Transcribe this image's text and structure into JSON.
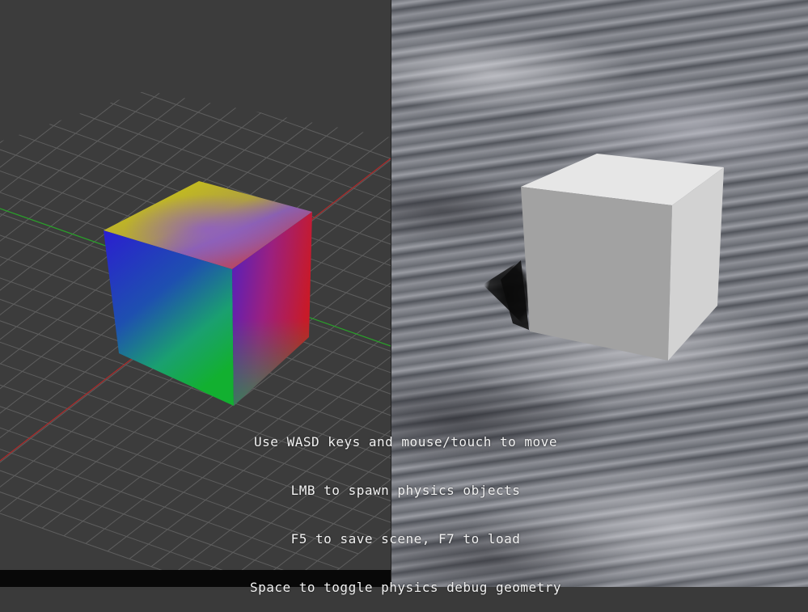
{
  "colors": {
    "editor_background": "#3c3c3c",
    "grid": "#606060",
    "x_axis": "#b02a2a",
    "z_axis": "#2aa02a",
    "status_bar": "#080808",
    "scene_cube": "#d8d8d8",
    "help_text": "#f2f2f2"
  },
  "left_viewport": {
    "object": "vertex-colored cube",
    "shows_grid": true,
    "shows_axes": true
  },
  "right_viewport": {
    "object": "white cube",
    "ground": "cloudy textured plane",
    "help_lines": [
      "Use WASD keys and mouse/touch to move",
      "LMB to spawn physics objects",
      "F5 to save scene, F7 to load",
      "Space to toggle physics debug geometry"
    ]
  }
}
